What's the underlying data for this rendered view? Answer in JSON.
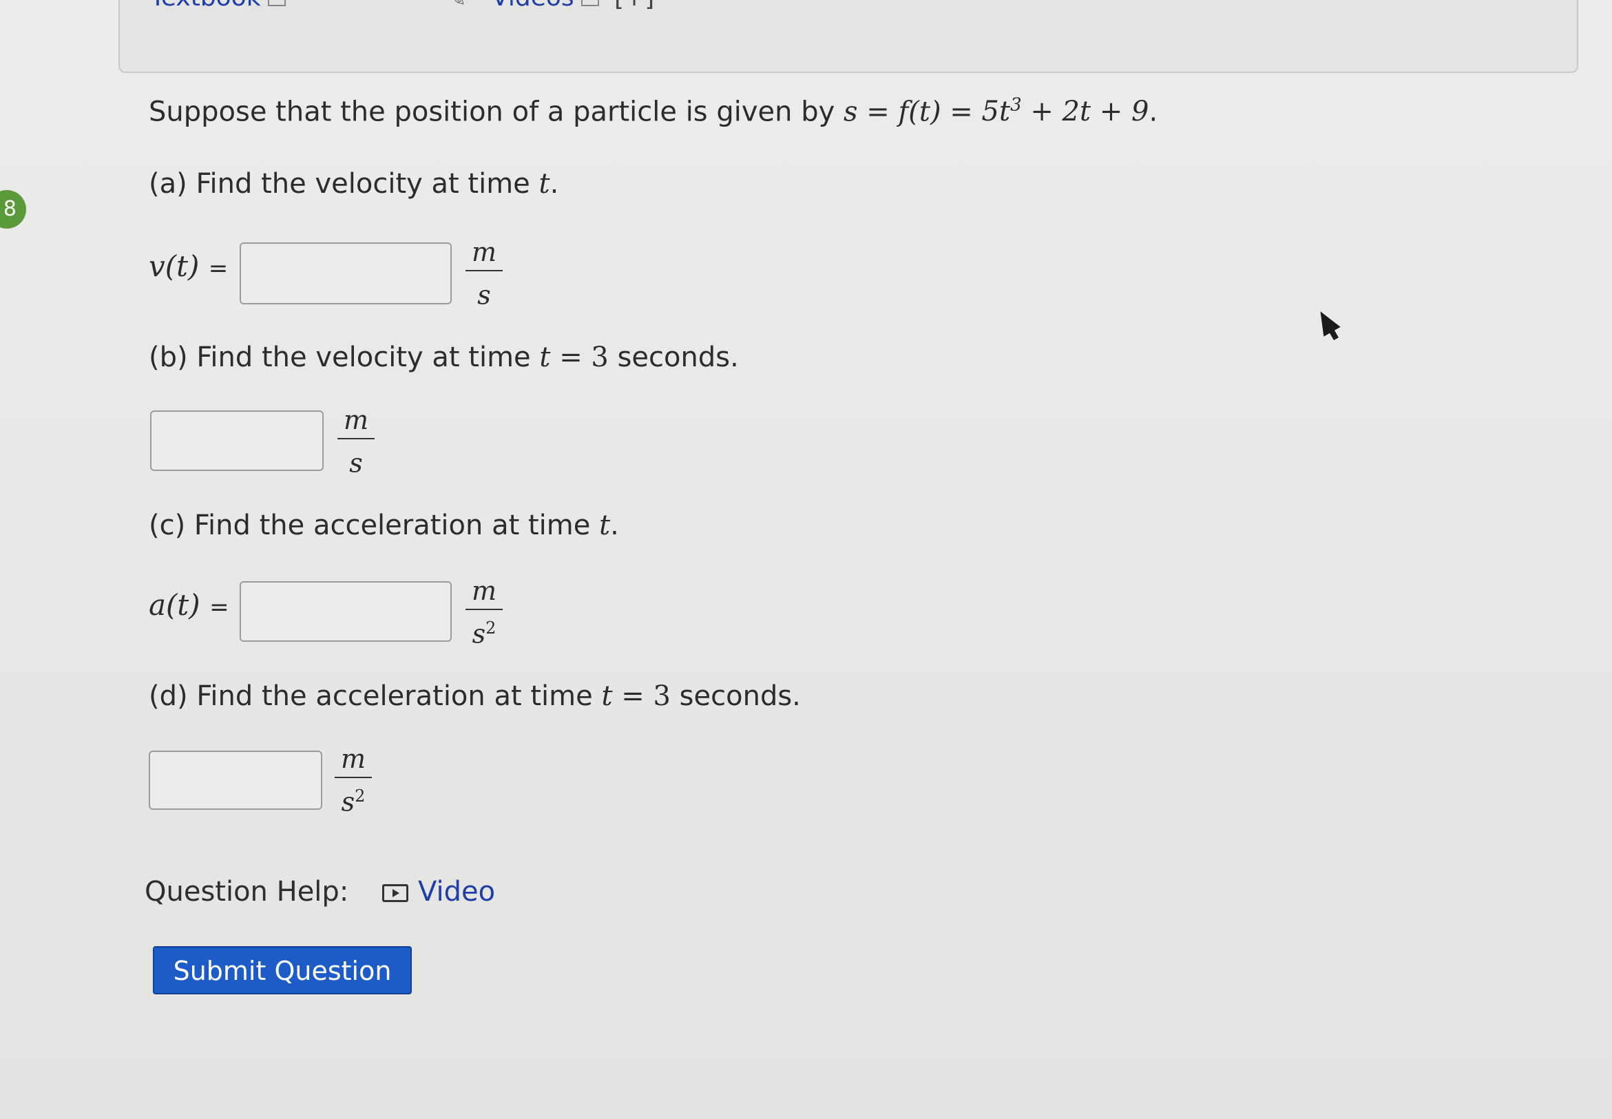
{
  "top_bar": {
    "textbook_label": "Textbook",
    "videos_label": "Videos",
    "plus_label": "[+]"
  },
  "question_number": "8",
  "problem": {
    "intro": "Suppose that the position of a particle is given by",
    "equation_s": "s",
    "equation_eq1": "=",
    "equation_f": "f(t)",
    "equation_eq2": "=",
    "equation_rhs_a": "5t",
    "equation_rhs_exp": "3",
    "equation_rhs_b": "+ 2t + 9",
    "period": "."
  },
  "parts": [
    {
      "prompt": "(a) Find the velocity at time",
      "var": "t",
      "tail": ".",
      "label": "v(t)",
      "equals": "=",
      "unit_num": "m",
      "unit_den": "s",
      "unit_exp": "",
      "value": ""
    },
    {
      "prompt": "(b) Find the velocity at time",
      "var": "t",
      "cond": "= 3",
      "tail": "seconds.",
      "label": "",
      "unit_num": "m",
      "unit_den": "s",
      "unit_exp": "",
      "value": ""
    },
    {
      "prompt": "(c) Find the acceleration at time",
      "var": "t",
      "tail": ".",
      "label": "a(t)",
      "equals": "=",
      "unit_num": "m",
      "unit_den": "s",
      "unit_exp": "2",
      "value": ""
    },
    {
      "prompt": "(d) Find the acceleration at time",
      "var": "t",
      "cond": "= 3",
      "tail": "seconds.",
      "label": "",
      "unit_num": "m",
      "unit_den": "s",
      "unit_exp": "2",
      "value": ""
    }
  ],
  "help": {
    "label": "Question Help:",
    "video_label": "Video"
  },
  "submit_label": "Submit Question"
}
